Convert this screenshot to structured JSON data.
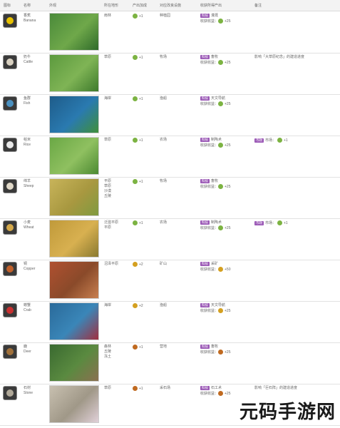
{
  "headers": [
    "图标",
    "名称",
    "外观",
    "所在地形",
    "产出加成",
    "对应改良设施",
    "收获所得产出",
    "备注"
  ],
  "culture_label": "收获收益：",
  "rows": [
    {
      "name": "香蕉",
      "en": "Banana",
      "terrain": [
        "雨林"
      ],
      "yield": "+1",
      "improvement": "种植园",
      "tech_tag": "科技",
      "tech": "灌溉",
      "harvest": "+25",
      "note_tag": "",
      "note": "",
      "note_val": "",
      "icon_color": "#e6c000",
      "yield_color": "#7cb342",
      "img_colors": [
        "#4a8a3a",
        "#6fa84a",
        "#2f6b2a"
      ]
    },
    {
      "name": "奶牛",
      "en": "Cattle",
      "terrain": [
        "草原"
      ],
      "yield": "+1",
      "improvement": "牧场",
      "tech_tag": "科技",
      "tech": "畜牧",
      "harvest": "+25",
      "note_tag": "",
      "note": "影响「大草原纪念」的建造进度",
      "note_val": "",
      "icon_color": "#d8d0c0",
      "yield_color": "#7cb342",
      "img_colors": [
        "#5c9a3e",
        "#7fb455",
        "#3e7a2c"
      ]
    },
    {
      "name": "鱼群",
      "en": "Fish",
      "terrain": [
        "海岸"
      ],
      "yield": "+1",
      "improvement": "渔船",
      "tech_tag": "科技",
      "tech": "天文导航",
      "harvest": "+25",
      "note_tag": "",
      "note": "",
      "note_val": "",
      "icon_color": "#4a90c0",
      "yield_color": "#7cb342",
      "img_colors": [
        "#1e5c8a",
        "#2a7ab0",
        "#3f8f3a"
      ]
    },
    {
      "name": "稻米",
      "en": "Rice",
      "terrain": [
        "草原"
      ],
      "yield": "+1",
      "improvement": "农场",
      "tech_tag": "科技",
      "tech": "制陶术",
      "harvest": "+25",
      "note_tag": "市政",
      "note": "市场：",
      "note_val": "+1",
      "icon_color": "#e8e8e8",
      "yield_color": "#7cb342",
      "img_colors": [
        "#6aa845",
        "#8fc060",
        "#4c8a32"
      ]
    },
    {
      "name": "绵羊",
      "en": "Sheep",
      "terrain": [
        "平原",
        "草原",
        "沙漠",
        "丘陵"
      ],
      "yield": "+1",
      "improvement": "牧场",
      "tech_tag": "科技",
      "tech": "畜牧",
      "harvest": "+25",
      "note_tag": "",
      "note": "",
      "note_val": "",
      "icon_color": "#e0d8c8",
      "yield_color": "#7cb342",
      "img_colors": [
        "#c8b45a",
        "#a89840",
        "#7f9a40"
      ]
    },
    {
      "name": "小麦",
      "en": "Wheat",
      "terrain": [
        "泛滥平原",
        "平原"
      ],
      "yield": "+1",
      "improvement": "农场",
      "tech_tag": "科技",
      "tech": "制陶术",
      "harvest": "+25",
      "note_tag": "市政",
      "note": "市场：",
      "note_val": "+1",
      "icon_color": "#d4a84a",
      "yield_color": "#7cb342",
      "img_colors": [
        "#c09a3a",
        "#d8b050",
        "#8a7a30"
      ]
    },
    {
      "name": "铜",
      "en": "Copper",
      "terrain": [
        "沼泽平原"
      ],
      "yield": "+2",
      "improvement": "矿山",
      "tech_tag": "科技",
      "tech": "采矿",
      "harvest": "+50",
      "note_tag": "",
      "note": "",
      "note_val": "",
      "icon_color": "#c0602a",
      "yield_color": "#d4a020",
      "img_colors": [
        "#b05030",
        "#8a4a2a",
        "#c88050"
      ]
    },
    {
      "name": "螃蟹",
      "en": "Crab",
      "terrain": [
        "海岸"
      ],
      "yield": "+2",
      "improvement": "渔船",
      "tech_tag": "科技",
      "tech": "天文导航",
      "harvest": "+25",
      "note_tag": "",
      "note": "",
      "note_val": "",
      "icon_color": "#c83030",
      "yield_color": "#d4a020",
      "img_colors": [
        "#2a6a9a",
        "#3a86b8",
        "#a03040"
      ]
    },
    {
      "name": "鹿",
      "en": "Deer",
      "terrain": [
        "森林",
        "丘陵",
        "冻土"
      ],
      "yield": "+1",
      "improvement": "营地",
      "tech_tag": "科技",
      "tech": "畜牧",
      "harvest": "+25",
      "note_tag": "",
      "note": "",
      "note_val": "",
      "icon_color": "#a0703a",
      "yield_color": "#c06a20",
      "img_colors": [
        "#3a6a30",
        "#5a8a40",
        "#8a7050"
      ]
    },
    {
      "name": "石材",
      "en": "Stone",
      "terrain": [
        "草原"
      ],
      "yield": "+1",
      "improvement": "采石场",
      "tech_tag": "科技",
      "tech": "石工术",
      "harvest": "+25",
      "note_tag": "",
      "note": "影响「巨石阵」的建造进度",
      "note_val": "",
      "icon_color": "#b0a898",
      "yield_color": "#c06a20",
      "img_colors": [
        "#c8c0b0",
        "#a09888",
        "#e0d0d8"
      ]
    }
  ],
  "watermark": "元码手游网"
}
